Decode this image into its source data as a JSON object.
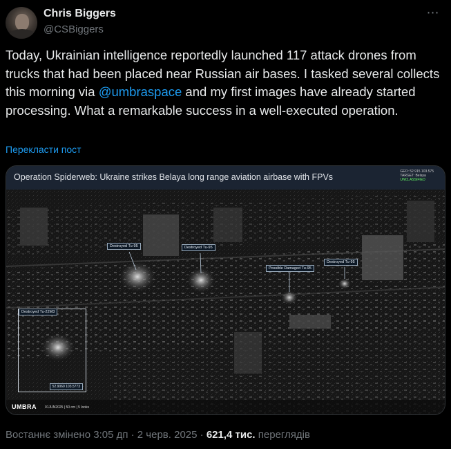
{
  "author": {
    "name": "Chris Biggers",
    "handle": "@CSBiggers"
  },
  "tweet": {
    "text_before": "Today, Ukrainian intelligence reportedly launched 117 attack drones from trucks that had been placed near Russian air bases. I tasked several collects this morning via ",
    "mention": "@umbraspace",
    "text_after": " and my first images have already started processing. What a remarkable success in a well-executed operation.",
    "translate": "Перекласти пост"
  },
  "media": {
    "title": "Operation Spiderweb: Ukraine strikes Belaya long range aviation airbase with FPVs",
    "geo": "GEO: 52.915 103.575",
    "target": "TARGET: Belaya",
    "classification": "UNCLASSIFIED",
    "labels": {
      "tu95_a": "Destroyed Tu-95",
      "tu95_b": "Destroyed Tu-95",
      "tu95_possible": "Possible Damaged Tu-95",
      "tu95_c": "Destroyed Tu-95",
      "tu22": "Destroyed Tu-22M3"
    },
    "inset_coord": "52.9060 103.5773",
    "brand": "UMBRA",
    "capture_info": "01JUN2025 | 50 cm | 5 looks"
  },
  "meta": {
    "edited": "Востаннє змінено 3:05 дп · 2 черв. 2025 · ",
    "views": "621,4 тис.",
    "views_label": " переглядів"
  },
  "colors": {
    "accent": "#1d9bf0",
    "text": "#e7e9ea",
    "muted": "#71767b",
    "background": "#000000"
  },
  "icons": {
    "more": "more-horizontal-icon"
  }
}
